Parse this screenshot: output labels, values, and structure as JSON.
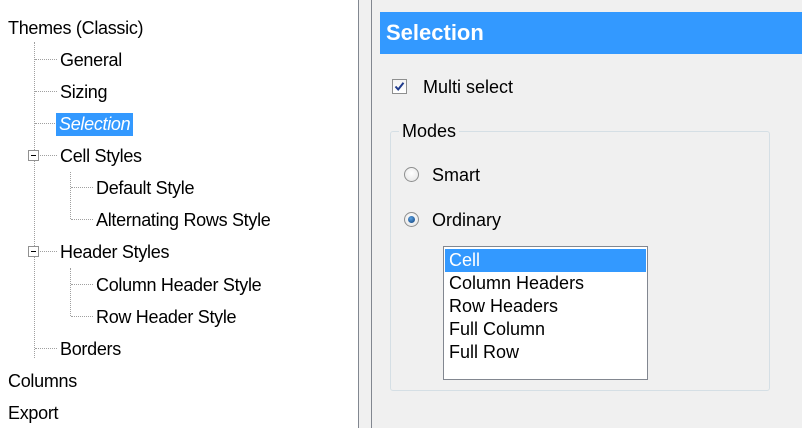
{
  "tree": {
    "items": [
      {
        "label": "Themes (Classic)"
      },
      {
        "label": "General"
      },
      {
        "label": "Sizing"
      },
      {
        "label": "Selection",
        "selected": true
      },
      {
        "label": "Cell Styles"
      },
      {
        "label": "Default Style"
      },
      {
        "label": "Alternating Rows Style"
      },
      {
        "label": "Header Styles"
      },
      {
        "label": "Column Header Style"
      },
      {
        "label": "Row Header Style"
      },
      {
        "label": "Borders"
      },
      {
        "label": "Columns"
      },
      {
        "label": "Export"
      }
    ]
  },
  "panel": {
    "title": "Selection",
    "multi_select": {
      "label": "Multi select",
      "checked": true
    },
    "modes": {
      "legend": "Modes",
      "options": [
        {
          "label": "Smart",
          "checked": false
        },
        {
          "label": "Ordinary",
          "checked": true
        }
      ],
      "list": {
        "items": [
          "Cell",
          "Column Headers",
          "Row Headers",
          "Full Column",
          "Full Row"
        ],
        "selected": "Cell"
      }
    }
  },
  "colors": {
    "accent": "#3399ff",
    "panel_bg": "#f0f0f0",
    "border": "#828790"
  },
  "icons": [
    "expander-minus-icon",
    "checkmark-icon",
    "radio-dot-icon"
  ]
}
